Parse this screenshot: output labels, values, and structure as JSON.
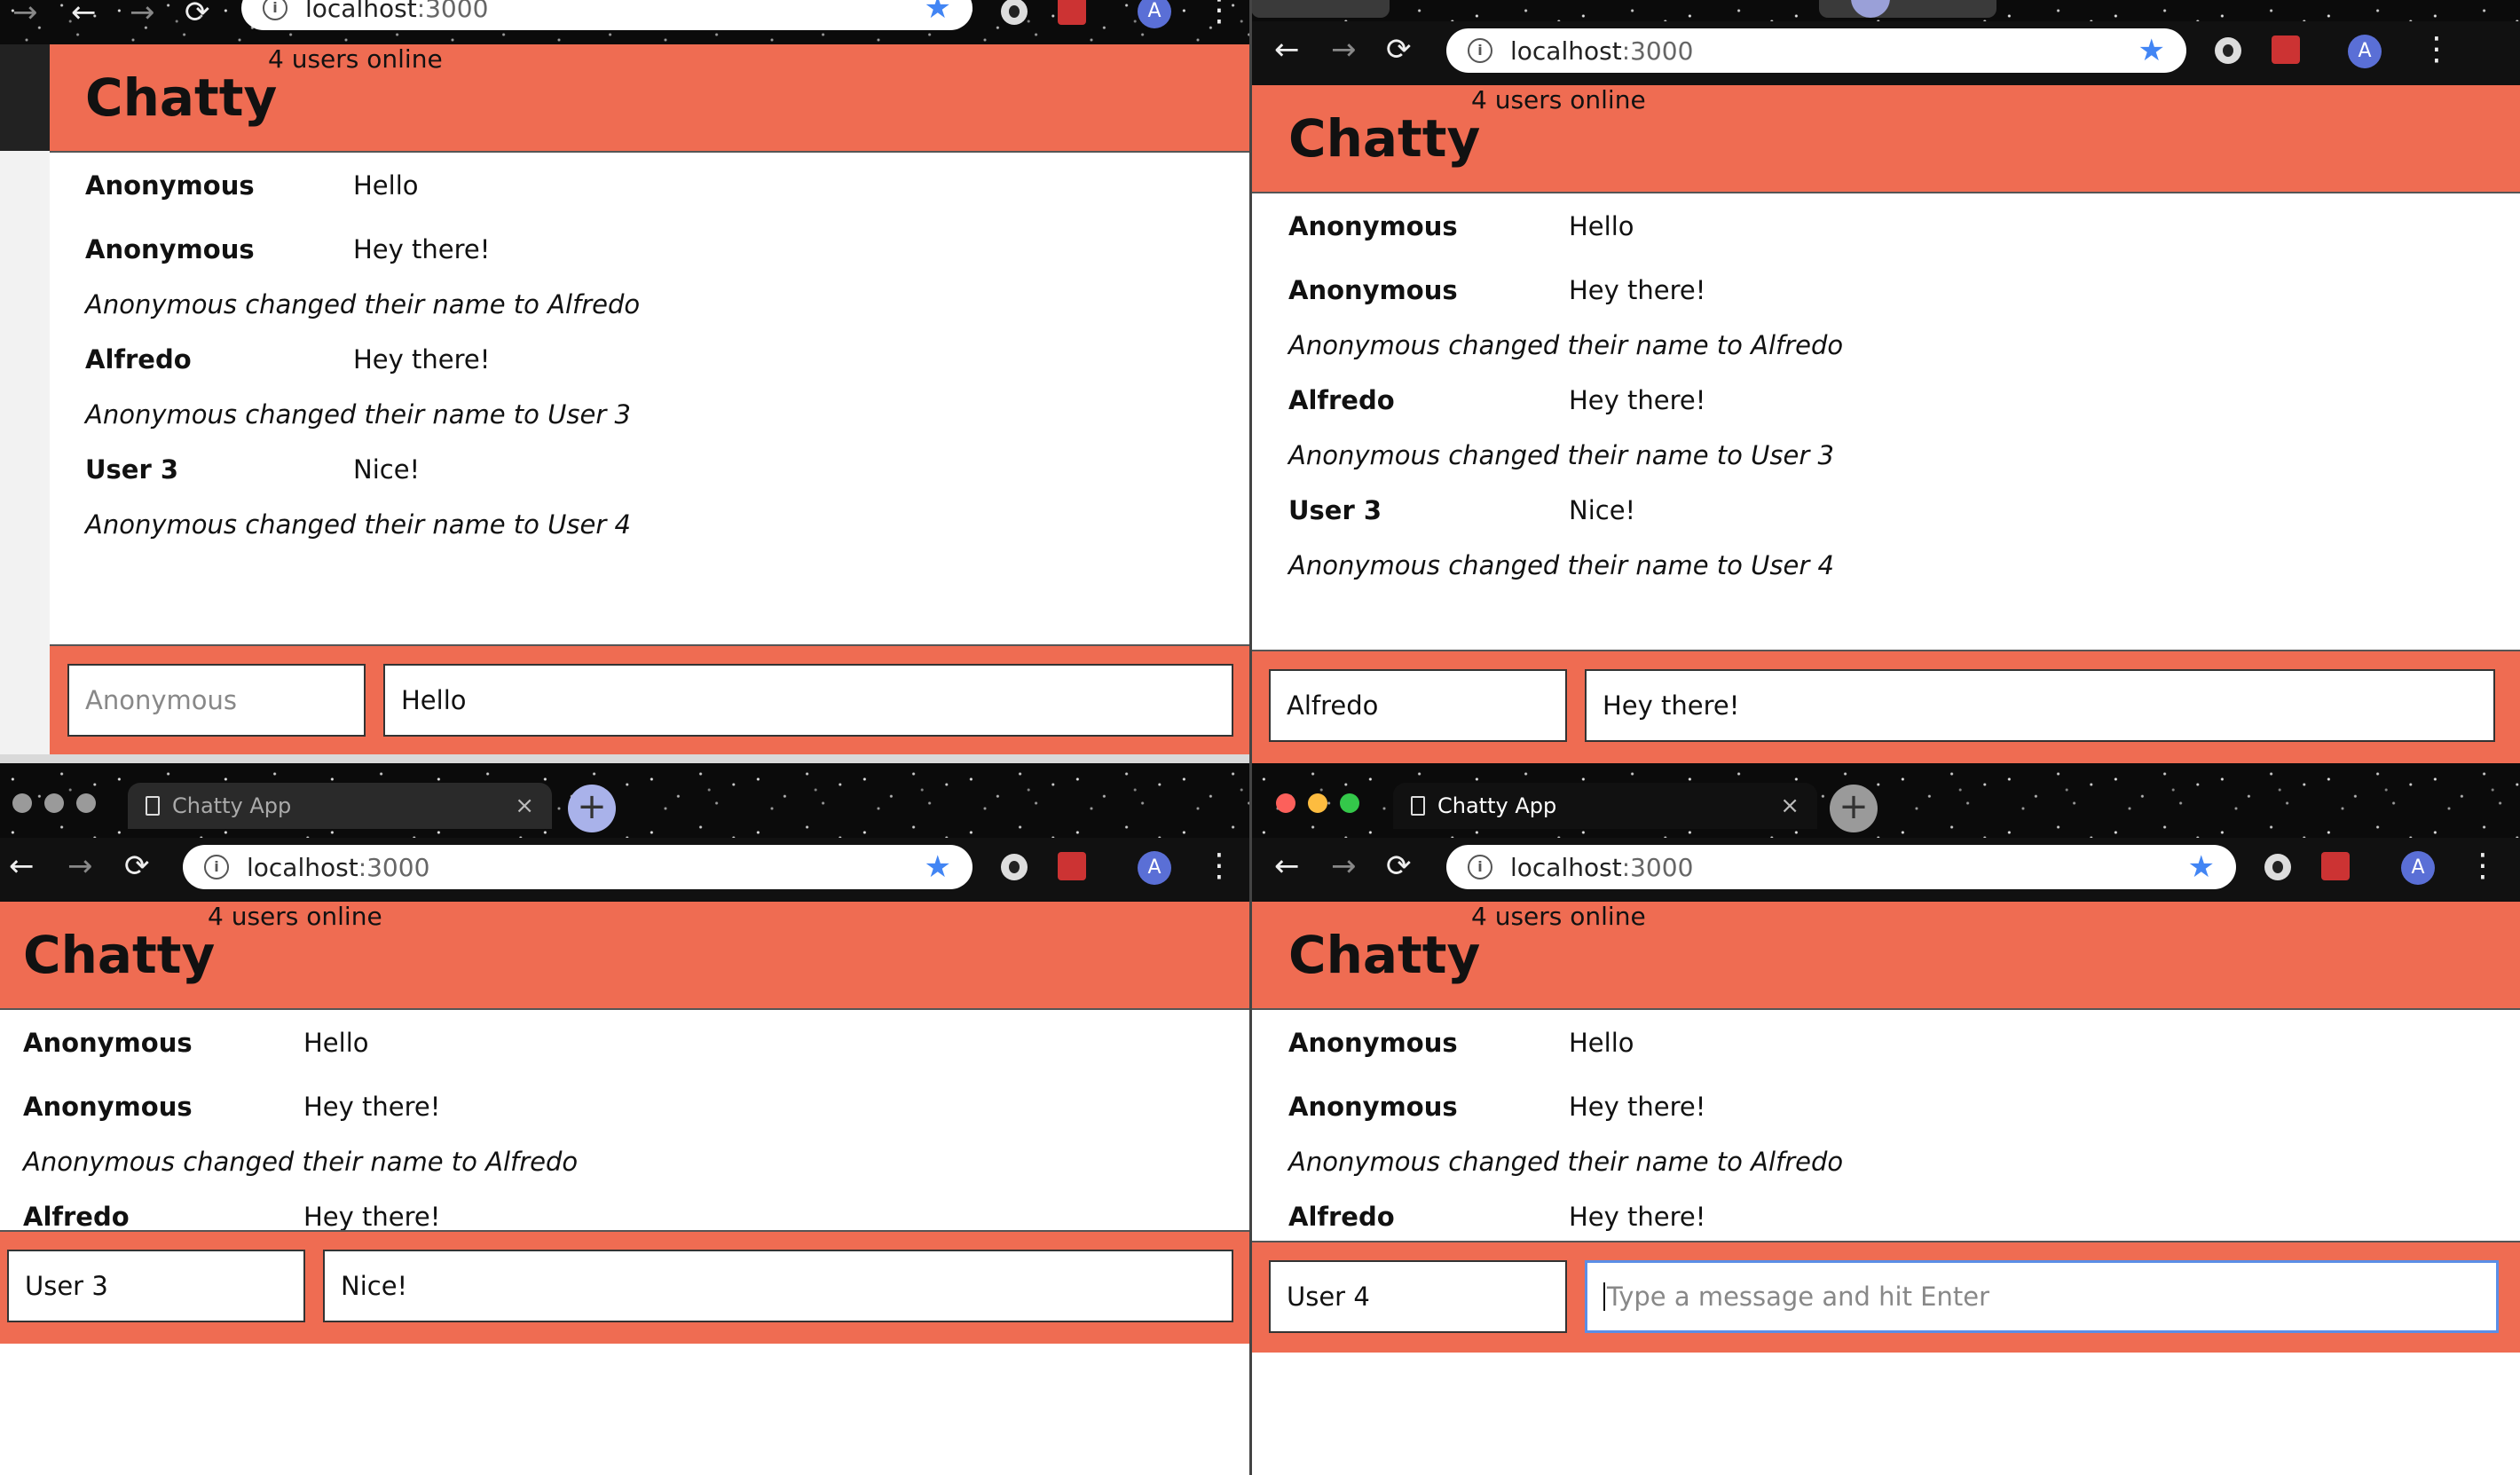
{
  "browser": {
    "url_host": "localhost",
    "url_port": ":3000",
    "tab_title": "Chatty App",
    "avatar_letter": "A"
  },
  "app": {
    "brand": "Chatty",
    "online": "4 users online"
  },
  "messages": [
    {
      "user": "Anonymous",
      "content": "Hello"
    },
    {
      "user": "Anonymous",
      "content": "Hey there!"
    },
    {
      "system": "Anonymous changed their name to Alfredo"
    },
    {
      "user": "Alfredo",
      "content": "Hey there!"
    },
    {
      "system": "Anonymous changed their name to User 3"
    },
    {
      "user": "User 3",
      "content": "Nice!"
    },
    {
      "system": "Anonymous changed their name to User 4"
    }
  ],
  "windows": {
    "w1": {
      "username_placeholder": "Anonymous",
      "message_value": "Hello"
    },
    "w2": {
      "username_value": "Alfredo",
      "message_value": "Hey there!"
    },
    "w3": {
      "username_value": "User 3",
      "message_value": "Nice!"
    },
    "w4": {
      "username_value": "User 4",
      "message_placeholder": "Type a message and hit Enter"
    }
  },
  "colors": {
    "navbar": "#ef6c52",
    "omnibox_star": "#4285f4",
    "focus_ring": "#5b8ee6"
  }
}
